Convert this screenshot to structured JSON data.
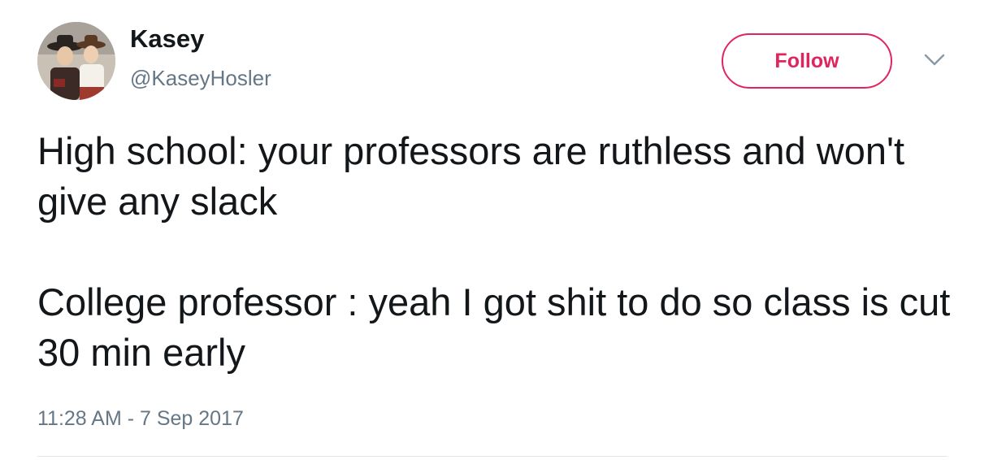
{
  "user": {
    "name": "Kasey",
    "handle": "@KaseyHosler"
  },
  "actions": {
    "follow_label": "Follow",
    "more_icon": "chevron-down-icon"
  },
  "tweet": {
    "paragraphs": [
      "High school: your professors are ruthless and won't give any slack",
      "College professor : yeah I got shit to do so class is cut 30 min early"
    ],
    "timestamp": "11:28 AM - 7 Sep 2017"
  },
  "colors": {
    "text": "#14171a",
    "secondary": "#657786",
    "follow_accent": "#e0245e",
    "divider": "#e1e8ed"
  }
}
